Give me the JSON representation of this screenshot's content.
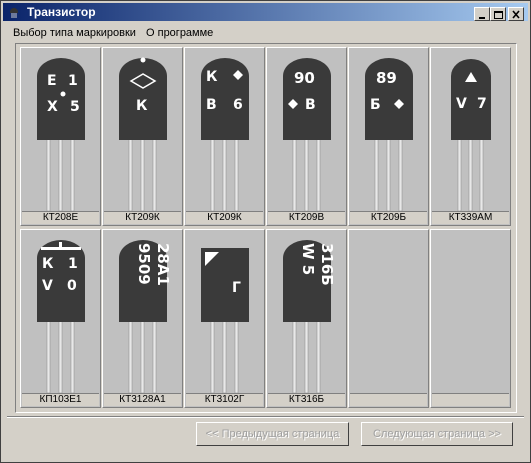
{
  "window": {
    "title": "Транзистор"
  },
  "menu": [
    "Выбор типа маркировки",
    "О программе"
  ],
  "transistors": [
    {
      "name": "КТ208Е",
      "lines": [
        "Е 1",
        "Х 5"
      ]
    },
    {
      "name": "КТ209К",
      "lines": [
        "К"
      ]
    },
    {
      "name": "КТ209К",
      "lines": [
        "К",
        "В 6"
      ]
    },
    {
      "name": "КТ209В",
      "lines": [
        "90",
        "В"
      ]
    },
    {
      "name": "КТ209Б",
      "lines": [
        "89",
        "Б"
      ]
    },
    {
      "name": "КТ339АМ",
      "lines": [
        "V 7"
      ]
    },
    {
      "name": "КП103Е1",
      "lines": [
        "К 1",
        "V 0"
      ]
    },
    {
      "name": "КТ3128А1",
      "lines": [
        "28А1",
        "9509"
      ]
    },
    {
      "name": "КТ3102Г",
      "lines": [
        "Г"
      ]
    },
    {
      "name": "КТ316Б",
      "lines": [
        "316Б",
        "W 5"
      ]
    }
  ],
  "buttons": {
    "prev": "<< Предыдущая страница",
    "next": "Следующая страница >>"
  }
}
